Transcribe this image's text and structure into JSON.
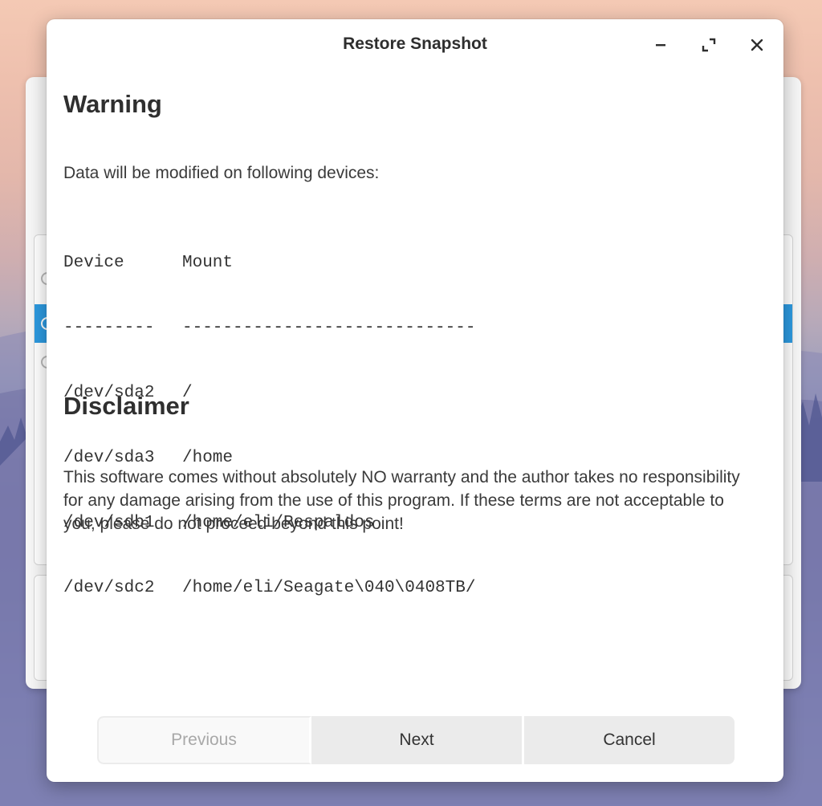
{
  "dialog": {
    "title": "Restore Snapshot",
    "window_controls": {
      "minimize_icon": "minimize-icon",
      "maximize_icon": "maximize-icon",
      "close_icon": "close-icon"
    }
  },
  "warning": {
    "heading": "Warning",
    "text": "Data will be modified on following devices:",
    "table": {
      "headers": [
        "Device",
        "Mount"
      ],
      "separators": [
        "---------",
        "-----------------------------"
      ],
      "rows": [
        [
          "/dev/sda2",
          "/"
        ],
        [
          "/dev/sda3",
          "/home"
        ],
        [
          "/dev/sdb1",
          "/home/eli/Respaldos"
        ],
        [
          "/dev/sdc2",
          "/home/eli/Seagate\\040\\0408TB/"
        ]
      ]
    }
  },
  "disclaimer": {
    "heading": "Disclaimer",
    "text": "This software comes without absolutely NO warranty and the author takes no responsibility for any damage arising from the use of this program. If these terms are not acceptable to you, please do not proceed beyond this point!"
  },
  "buttons": {
    "previous": "Previous",
    "next": "Next",
    "cancel": "Cancel"
  },
  "colors": {
    "selection_accent": "#2d9ae0",
    "dialog_bg": "#ffffff",
    "button_bg": "#ebebeb"
  }
}
